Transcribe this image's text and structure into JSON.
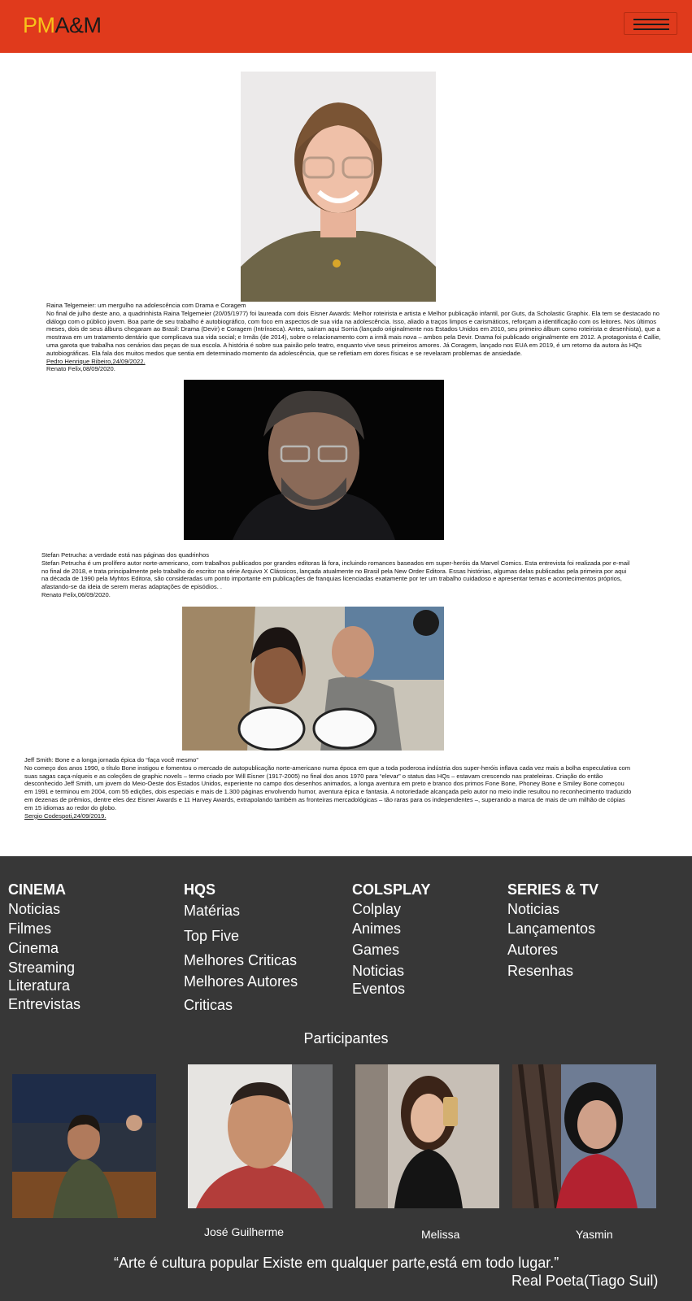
{
  "header": {
    "logo_pm": "PM",
    "logo_am": "A&M",
    "menu_icon": "hamburger-menu-icon"
  },
  "articles": [
    {
      "title": "Raina Telgemeier: um mergulho na adolescência com Drama e Coragem",
      "body": "No final de julho deste ano, a quadrinhista Raina Telgemeier (20/05/1977) foi laureada com dois Eisner Awards: Melhor roteirista e artista e Melhor publicação infantil, por Guts, da Scholastic Graphix. Ela tem se destacado no diálogo com o público jovem. Boa parte de seu trabalho é autobiográfico, com foco em aspectos de sua vida na adolescência. Isso, aliado a traços limpos e carismáticos, reforçam a identificação com os leitores. Nos últimos meses, dois de seus álbuns chegaram ao Brasil: Drama (Devir) e Coragem (Intrínseca). Antes, saíram aqui Sorria (lançado originalmente nos Estados Unidos em 2010, seu primeiro álbum como roteirista e desenhista), que a mostrava em um tratamento dentário que complicava sua vida social; e Irmãs (de 2014), sobre o relacionamento com a irmã mais nova – ambos pela Devir. Drama foi publicado originalmente em 2012. A protagonista é Callie, uma garota que trabalha nos cenários das peças de sua escola. A história é sobre sua paixão pelo teatro, enquanto vive seus primeiros amores. Já Coragem, lançado nos EUA em 2019, é um retorno da autora às HQs autobiográficas. Ela fala dos muitos medos que sentia em determinado momento da adolescência, que se refletiam em dores físicas e se revelaram problemas de ansiedade.",
      "author": "Pedro Henrique Ribeiro,24/09/2022.",
      "author2": "Renato Felix,08/09/2020."
    },
    {
      "title": "Stefan Petrucha: a verdade está nas páginas dos quadrinhos",
      "body": "Stefan Petrucha é um prolífero autor norte-americano, com trabalhos publicados por grandes editoras lá fora, incluindo romances baseados em super-heróis da Marvel Comics. Esta entrevista foi realizada por e-mail no final de 2018, e trata principalmente pelo trabalho do escritor na série Arquivo X Clássicos, lançada atualmente no Brasil pela New Order Editora. Essas histórias, algumas delas publicadas pela primeira por aqui na década de 1990 pela Myhtos Editora, são consideradas um ponto importante em publicações de franquias licenciadas exatamente por ter um trabalho cuidadoso e apresentar temas e acontecimentos próprios, afastando-se da ideia de serem meras adaptações de episódios. .",
      "author2": "Renato Felix,06/09/2020."
    },
    {
      "title": "Jeff Smith: Bone e a longa jornada épica do “faça você mesmo”",
      "body": "No começo dos anos 1990, o título Bone instigou e fomentou o mercado de autopublicação norte-americano numa época em que a toda poderosa indústria dos super-heróis inflava cada vez mais a bolha especulativa com suas sagas caça-níqueis e as coleções de graphic novels – termo criado por Will Eisner (1917-2005) no final dos anos 1970 para “elevar” o status das HQs – estavam crescendo nas prateleiras. Criação do então desconhecido Jeff Smith, um jovem do Meio-Oeste dos Estados Unidos, experiente no campo dos desenhos animados, a longa aventura em preto e branco dos primos Fone Bone, Phoney Bone e Smiley Bone começou em 1991 e terminou em 2004, com 55 edições, dois especiais e mais de 1.300 páginas envolvendo humor, aventura épica e fantasia. A notoriedade alcançada pelo autor no meio indie resultou no reconhecimento traduzido em dezenas de prêmios, dentre eles dez Eisner Awards e 11 Harvey Awards, extrapolando também as fronteiras mercadológicas – tão raras para os independentes –, superando a marca de mais de um milhão de cópias em 15 idiomas ao redor do globo.",
      "author": "Sergio Codespoti,24/09/2019."
    }
  ],
  "footer": {
    "columns": [
      {
        "title": "CINEMA",
        "links": [
          "Noticias",
          "Filmes",
          "Cinema",
          "Streaming",
          "Literatura",
          "Entrevistas"
        ]
      },
      {
        "title": "HQS",
        "links": [
          "Matérias",
          "Top Five",
          "Melhores Criticas",
          "Melhores Autores",
          "Criticas"
        ]
      },
      {
        "title": "COLSPLAY",
        "links": [
          "Colplay",
          "Animes",
          "Games",
          "Noticias",
          "Eventos"
        ]
      },
      {
        "title": "SERIES & TV",
        "links": [
          "Noticias",
          "Lançamentos",
          "Autores",
          "Resenhas"
        ]
      }
    ],
    "participants_title": "Participantes",
    "participants": [
      {
        "name": ""
      },
      {
        "name": "José Guilherme"
      },
      {
        "name": "Melissa"
      },
      {
        "name": "Yasmin"
      }
    ],
    "quote": "“Arte é cultura popular Existe em qualquer parte,está em todo lugar.”",
    "quote_author": "Real Poeta(Tiago Suil)"
  }
}
